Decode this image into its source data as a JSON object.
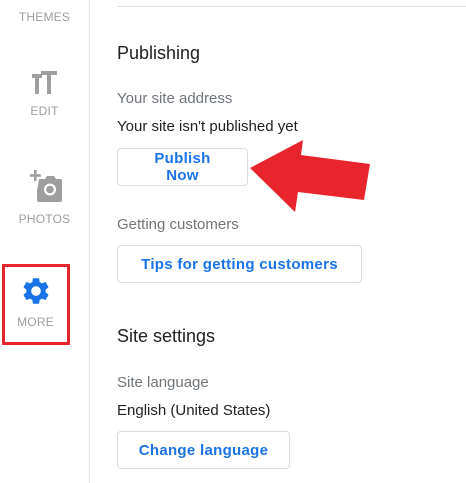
{
  "sidebar": {
    "items": [
      {
        "label": "THEMES",
        "icon": "themes-icon"
      },
      {
        "label": "EDIT",
        "icon": "text-format-icon"
      },
      {
        "label": "PHOTOS",
        "icon": "add-photo-icon"
      },
      {
        "label": "MORE",
        "icon": "gear-icon",
        "active": true
      }
    ]
  },
  "publishing": {
    "title": "Publishing",
    "address_label": "Your site address",
    "address_value": "Your site isn't published yet",
    "publish_button": "Publish Now",
    "customers_label": "Getting customers",
    "customers_button": "Tips for getting customers"
  },
  "site_settings": {
    "title": "Site settings",
    "language_label": "Site language",
    "language_value": "English (United States)",
    "language_button": "Change language"
  },
  "colors": {
    "accent": "#1a73e8",
    "annotation_red": "#e8242c",
    "muted": "#9e9e9e"
  }
}
